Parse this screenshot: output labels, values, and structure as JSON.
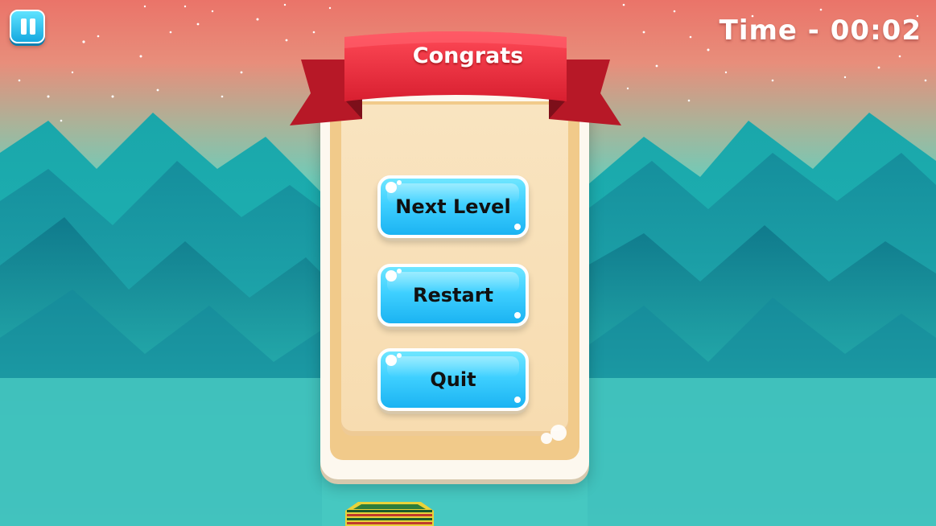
{
  "hud": {
    "timer_text": "Time - 00:02",
    "pause_icon": "pause-icon"
  },
  "dialog": {
    "title": "Congrats",
    "buttons": [
      {
        "label": "Next Level"
      },
      {
        "label": "Restart"
      },
      {
        "label": "Quit"
      }
    ]
  },
  "colors": {
    "sky_top": "#e8786c",
    "sky_mid": "#7cc4b4",
    "teal": "#34c9c4",
    "ribbon": "#e22a3a",
    "button": "#3fd0ff",
    "panel": "#f9e4c0"
  }
}
